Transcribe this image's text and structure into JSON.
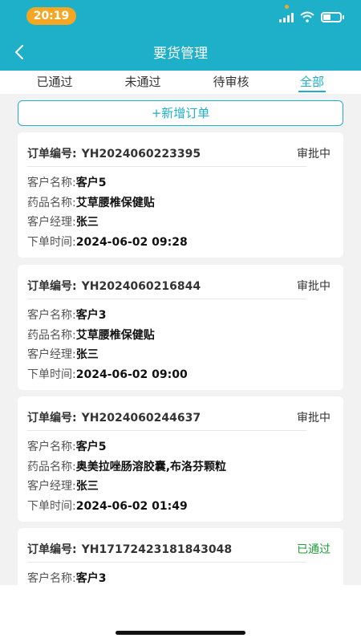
{
  "status_bar": {
    "time": "20:19"
  },
  "header": {
    "title": "要货管理"
  },
  "tabs": [
    {
      "label": "已通过",
      "active": false
    },
    {
      "label": "未通过",
      "active": false
    },
    {
      "label": "待审核",
      "active": false
    },
    {
      "label": "全部",
      "active": true
    }
  ],
  "add_button": {
    "label": "+新增订单"
  },
  "field_labels": {
    "order_no": "订单编号:",
    "customer": "客户名称:",
    "drug": "药品名称:",
    "manager": "客户经理:",
    "time": "下单时间:"
  },
  "orders": [
    {
      "order_no": "YH2024060223395",
      "status": "审批中",
      "customer": "客户5",
      "drug": "艾草腰椎保健贴",
      "manager": "张三",
      "time": "2024-06-02 09:28"
    },
    {
      "order_no": "YH2024060216844",
      "status": "审批中",
      "customer": "客户3",
      "drug": "艾草腰椎保健贴",
      "manager": "张三",
      "time": "2024-06-02 09:00"
    },
    {
      "order_no": "YH2024060244637",
      "status": "审批中",
      "customer": "客户5",
      "drug": "奥美拉唑肠溶胶囊,布洛芬颗粒",
      "manager": "张三",
      "time": "2024-06-02 01:49"
    },
    {
      "order_no": "YH17172423181843048",
      "status": "已通过",
      "customer": "客户3"
    }
  ],
  "colors": {
    "primary": "#1fb0c9",
    "status_pill": "#f5a623",
    "approved": "#1e9c3a"
  }
}
